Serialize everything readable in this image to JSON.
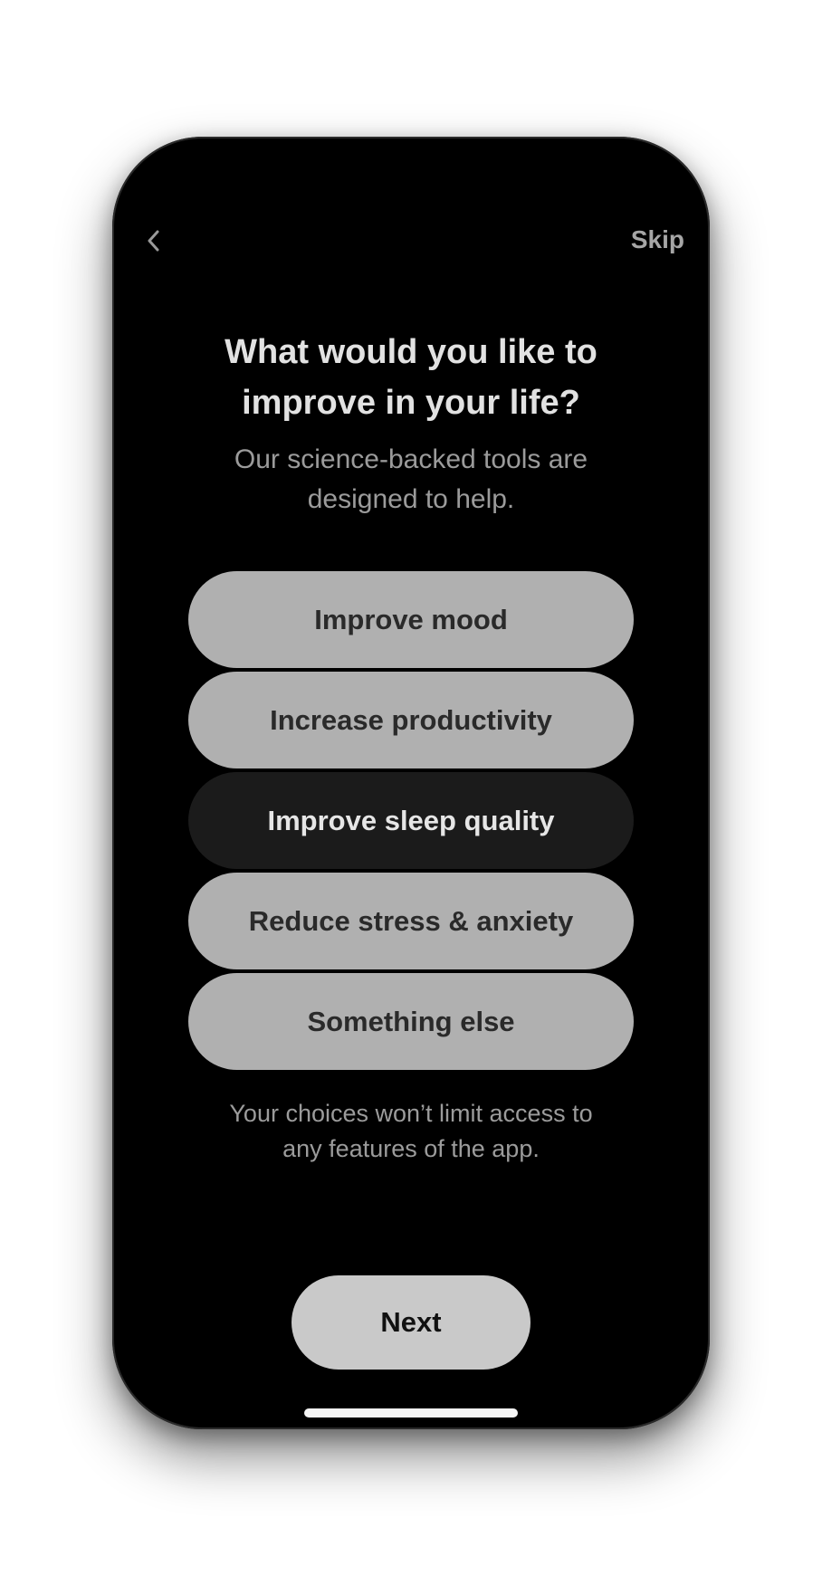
{
  "header": {
    "back_icon": "chevron-left-icon",
    "skip_label": "Skip"
  },
  "question": {
    "title_line1": "What would you like to",
    "title_line2": "improve in your life?",
    "subtitle_line1": "Our science-backed tools are",
    "subtitle_line2": "designed to help."
  },
  "options": [
    {
      "label": "Improve mood",
      "selected": false
    },
    {
      "label": "Increase productivity",
      "selected": false
    },
    {
      "label": "Improve sleep quality",
      "selected": true
    },
    {
      "label": "Reduce stress & anxiety",
      "selected": false
    },
    {
      "label": "Something else",
      "selected": false
    }
  ],
  "footnote": {
    "line1": "Your choices won’t limit access to",
    "line2": "any features of the app."
  },
  "next_label": "Next",
  "colors": {
    "screen_bg": "#000000",
    "option_bg": "#b0b0b0",
    "option_selected_bg": "#1b1b1b",
    "button_bg": "#c9c9c9"
  }
}
